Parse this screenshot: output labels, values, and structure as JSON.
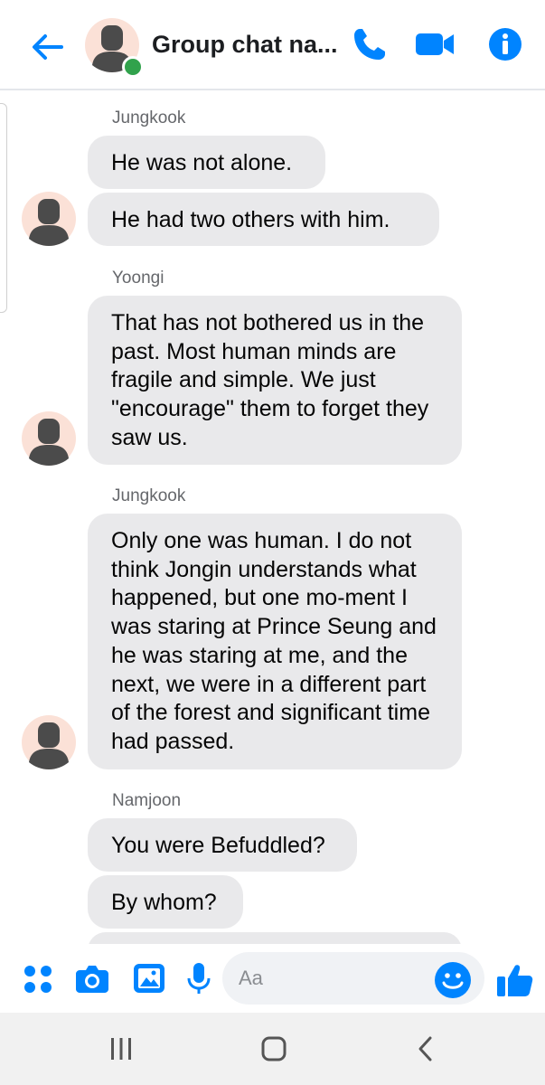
{
  "header": {
    "title": "Group chat na...",
    "icons": [
      "back-arrow-icon",
      "phone-icon",
      "video-camera-icon",
      "info-icon"
    ]
  },
  "colors": {
    "accent": "#0084ff",
    "bubble": "#e9e9eb",
    "online": "#31a24c",
    "avatar_bg": "#fbe1d7",
    "avatar_figure": "#4b4b4b"
  },
  "messages": [
    {
      "sender": "Jungkook",
      "bubbles": [
        "He was not alone.",
        "He had two others with him."
      ]
    },
    {
      "sender": "Yoongi",
      "bubbles": [
        "That has not bothered us in the past. Most human minds are fragile and simple. We just \"encourage\" them to forget they saw us."
      ]
    },
    {
      "sender": "Jungkook",
      "bubbles": [
        "Only one was human. I do not think Jongin understands what happened, but one mo-ment I was staring at Prince Seung and he was staring at me, and the next, we were in a different part of the forest and significant time had passed."
      ]
    },
    {
      "sender": "Namjoon",
      "bubbles": [
        "You were Befuddled?",
        "By whom?"
      ]
    }
  ],
  "composer": {
    "placeholder": "Aa",
    "value": "",
    "icons": [
      "apps-grid-icon",
      "camera-icon",
      "gallery-icon",
      "microphone-icon",
      "emoji-icon",
      "thumbs-up-icon"
    ]
  },
  "navbar": {
    "icons": [
      "recent-apps-icon",
      "home-icon",
      "back-icon"
    ]
  }
}
